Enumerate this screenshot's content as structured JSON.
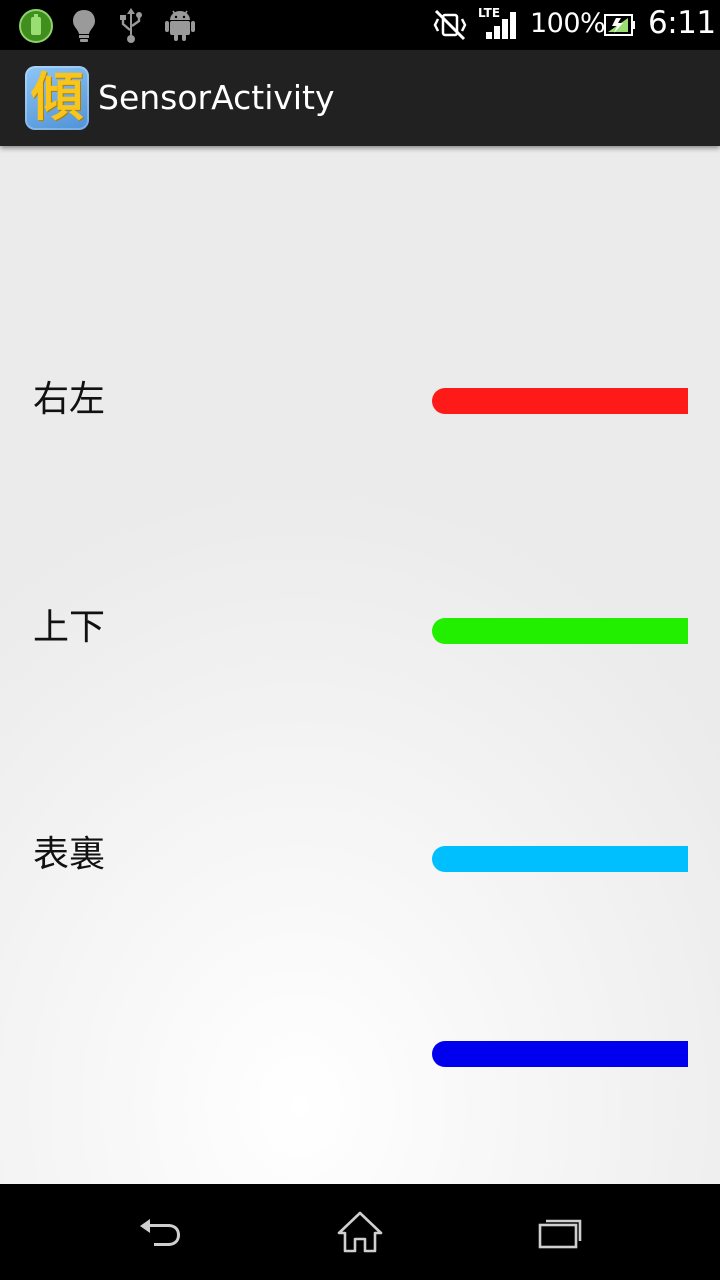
{
  "status_bar": {
    "battery_text": "100%",
    "time": "6:11",
    "network_label": "LTE"
  },
  "action_bar": {
    "app_icon_glyph": "傾",
    "title": "SensorActivity"
  },
  "sensors": [
    {
      "label": "右左",
      "color": "#ff1a1a"
    },
    {
      "label": "上下",
      "color": "#22ee00"
    },
    {
      "label": "表裏",
      "color": "#00bfff"
    },
    {
      "label": "",
      "color": "#0000ee"
    }
  ],
  "nav": {
    "back": "back-icon",
    "home": "home-icon",
    "recents": "recents-icon"
  }
}
